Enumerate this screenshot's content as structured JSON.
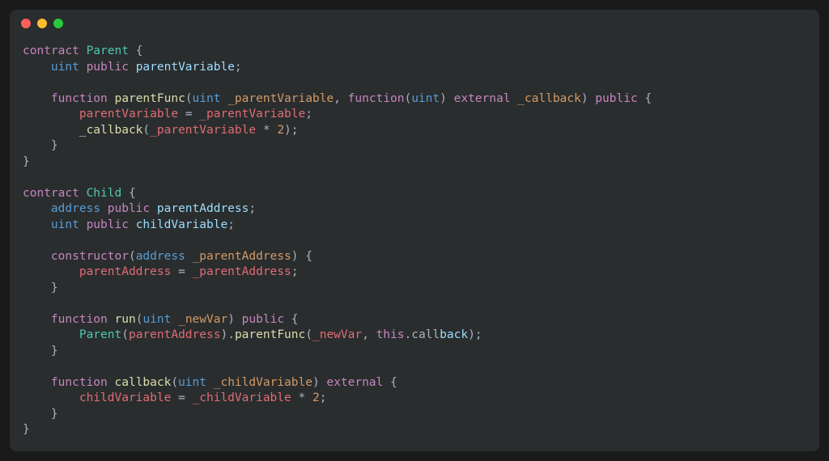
{
  "window": {
    "traffic": [
      "red",
      "yellow",
      "green"
    ]
  },
  "colors": {
    "bg": "#1a1a1a",
    "editorBg": "#2a2d2e",
    "red": "#ff5f56",
    "yellow": "#ffbd2e",
    "green": "#27c93f",
    "keyword": "#c586c0",
    "type": "#569cd6",
    "class": "#4ec9b0",
    "function": "#dcdcaa",
    "param": "#d19a66",
    "variable": "#e06c75",
    "property": "#9cdcfe",
    "punctuation": "#abb2bf",
    "foreground": "#d4d4d4",
    "number": "#d19a66"
  },
  "code": {
    "language": "solidity",
    "lines": [
      [
        {
          "t": "contract ",
          "c": "kw"
        },
        {
          "t": "Parent ",
          "c": "class"
        },
        {
          "t": "{",
          "c": "punc"
        }
      ],
      [
        {
          "t": "    ",
          "c": ""
        },
        {
          "t": "uint ",
          "c": "type"
        },
        {
          "t": "public ",
          "c": "kw"
        },
        {
          "t": "parentVariable",
          "c": "prop"
        },
        {
          "t": ";",
          "c": "punc"
        }
      ],
      [],
      [
        {
          "t": "    ",
          "c": ""
        },
        {
          "t": "function ",
          "c": "kw"
        },
        {
          "t": "parentFunc",
          "c": "fn"
        },
        {
          "t": "(",
          "c": "punc"
        },
        {
          "t": "uint ",
          "c": "type"
        },
        {
          "t": "_parentVariable",
          "c": "param"
        },
        {
          "t": ", ",
          "c": "punc"
        },
        {
          "t": "function",
          "c": "kw"
        },
        {
          "t": "(",
          "c": "punc"
        },
        {
          "t": "uint",
          "c": "type"
        },
        {
          "t": ") ",
          "c": "punc"
        },
        {
          "t": "external ",
          "c": "kw"
        },
        {
          "t": "_callback",
          "c": "param"
        },
        {
          "t": ") ",
          "c": "punc"
        },
        {
          "t": "public ",
          "c": "kw"
        },
        {
          "t": "{",
          "c": "punc"
        }
      ],
      [
        {
          "t": "        ",
          "c": ""
        },
        {
          "t": "parentVariable ",
          "c": "var"
        },
        {
          "t": "= ",
          "c": "punc"
        },
        {
          "t": "_parentVariable",
          "c": "var"
        },
        {
          "t": ";",
          "c": "punc"
        }
      ],
      [
        {
          "t": "        ",
          "c": ""
        },
        {
          "t": "_callback",
          "c": "fn"
        },
        {
          "t": "(",
          "c": "punc"
        },
        {
          "t": "_parentVariable ",
          "c": "var"
        },
        {
          "t": "* ",
          "c": "punc"
        },
        {
          "t": "2",
          "c": "num"
        },
        {
          "t": ");",
          "c": "punc"
        }
      ],
      [
        {
          "t": "    }",
          "c": "punc"
        }
      ],
      [
        {
          "t": "}",
          "c": "punc"
        }
      ],
      [],
      [
        {
          "t": "contract ",
          "c": "kw"
        },
        {
          "t": "Child ",
          "c": "class"
        },
        {
          "t": "{",
          "c": "punc"
        }
      ],
      [
        {
          "t": "    ",
          "c": ""
        },
        {
          "t": "address ",
          "c": "type"
        },
        {
          "t": "public ",
          "c": "kw"
        },
        {
          "t": "parentAddress",
          "c": "prop"
        },
        {
          "t": ";",
          "c": "punc"
        }
      ],
      [
        {
          "t": "    ",
          "c": ""
        },
        {
          "t": "uint ",
          "c": "type"
        },
        {
          "t": "public ",
          "c": "kw"
        },
        {
          "t": "childVariable",
          "c": "prop"
        },
        {
          "t": ";",
          "c": "punc"
        }
      ],
      [],
      [
        {
          "t": "    ",
          "c": ""
        },
        {
          "t": "constructor",
          "c": "kw"
        },
        {
          "t": "(",
          "c": "punc"
        },
        {
          "t": "address ",
          "c": "type"
        },
        {
          "t": "_parentAddress",
          "c": "param"
        },
        {
          "t": ") {",
          "c": "punc"
        }
      ],
      [
        {
          "t": "        ",
          "c": ""
        },
        {
          "t": "parentAddress ",
          "c": "var"
        },
        {
          "t": "= ",
          "c": "punc"
        },
        {
          "t": "_parentAddress",
          "c": "var"
        },
        {
          "t": ";",
          "c": "punc"
        }
      ],
      [
        {
          "t": "    }",
          "c": "punc"
        }
      ],
      [],
      [
        {
          "t": "    ",
          "c": ""
        },
        {
          "t": "function ",
          "c": "kw"
        },
        {
          "t": "run",
          "c": "fn"
        },
        {
          "t": "(",
          "c": "punc"
        },
        {
          "t": "uint ",
          "c": "type"
        },
        {
          "t": "_newVar",
          "c": "param"
        },
        {
          "t": ") ",
          "c": "punc"
        },
        {
          "t": "public ",
          "c": "kw"
        },
        {
          "t": "{",
          "c": "punc"
        }
      ],
      [
        {
          "t": "        ",
          "c": ""
        },
        {
          "t": "Parent",
          "c": "class"
        },
        {
          "t": "(",
          "c": "punc"
        },
        {
          "t": "parentAddress",
          "c": "var"
        },
        {
          "t": ").",
          "c": "punc"
        },
        {
          "t": "parentFunc",
          "c": "fn"
        },
        {
          "t": "(",
          "c": "punc"
        },
        {
          "t": "_newVar",
          "c": "var"
        },
        {
          "t": ", ",
          "c": "punc"
        },
        {
          "t": "this",
          "c": "kw"
        },
        {
          "t": ".call",
          "c": "punc"
        },
        {
          "t": "back",
          "c": "prop"
        },
        {
          "t": ");",
          "c": "punc"
        }
      ],
      [
        {
          "t": "    }",
          "c": "punc"
        }
      ],
      [],
      [
        {
          "t": "    ",
          "c": ""
        },
        {
          "t": "function ",
          "c": "kw"
        },
        {
          "t": "callback",
          "c": "fn"
        },
        {
          "t": "(",
          "c": "punc"
        },
        {
          "t": "uint ",
          "c": "type"
        },
        {
          "t": "_childVariable",
          "c": "param"
        },
        {
          "t": ") ",
          "c": "punc"
        },
        {
          "t": "external ",
          "c": "kw"
        },
        {
          "t": "{",
          "c": "punc"
        }
      ],
      [
        {
          "t": "        ",
          "c": ""
        },
        {
          "t": "childVariable ",
          "c": "var"
        },
        {
          "t": "= ",
          "c": "punc"
        },
        {
          "t": "_childVariable ",
          "c": "var"
        },
        {
          "t": "* ",
          "c": "punc"
        },
        {
          "t": "2",
          "c": "num"
        },
        {
          "t": ";",
          "c": "punc"
        }
      ],
      [
        {
          "t": "    }",
          "c": "punc"
        }
      ],
      [
        {
          "t": "}",
          "c": "punc"
        }
      ]
    ]
  }
}
